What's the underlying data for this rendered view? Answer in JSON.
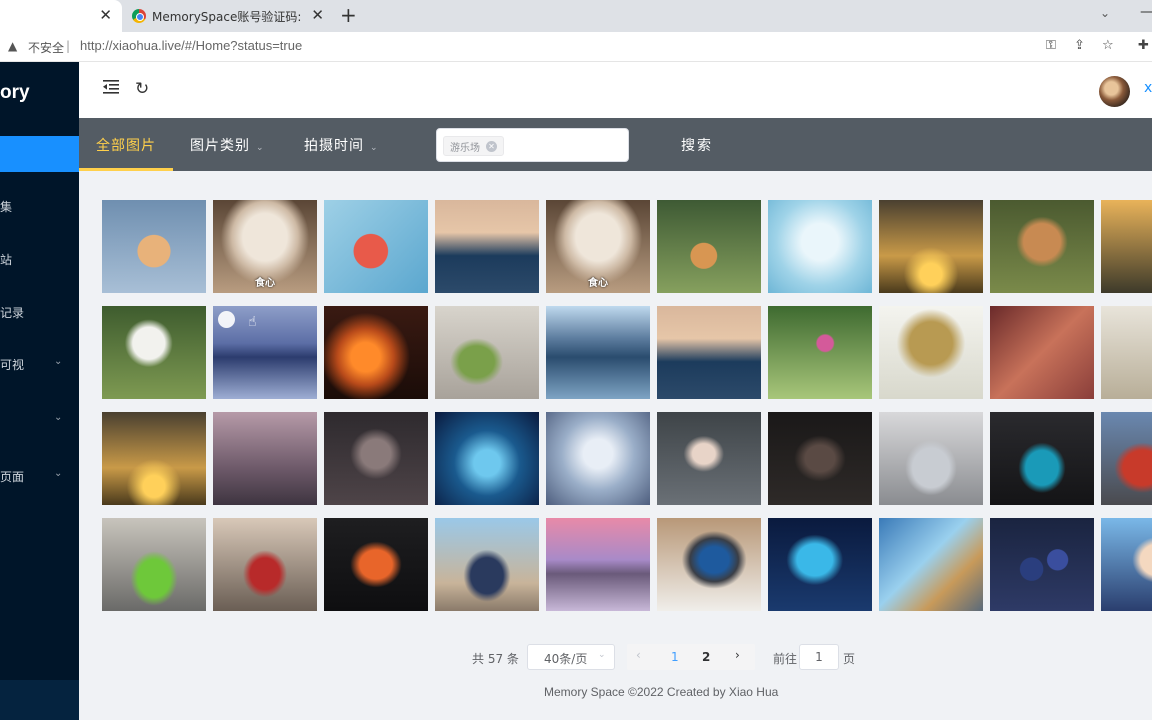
{
  "browser": {
    "tabs": [
      {
        "title": ""
      },
      {
        "title": "MemorySpace账号验证码: - C"
      }
    ],
    "new_tab": "+",
    "close_glyph": "✕",
    "insecure_label": "不安全",
    "url": "http://xiaohua.live/#/Home?status=true"
  },
  "sidebar": {
    "logo": "ory",
    "items": [
      {
        "label": "集",
        "arrow": false
      },
      {
        "label": "站",
        "arrow": false
      },
      {
        "label": "记录",
        "arrow": false
      },
      {
        "label": "可视",
        "arrow": true
      },
      {
        "label": "",
        "arrow": true
      },
      {
        "label": "页面",
        "arrow": true
      }
    ]
  },
  "header": {
    "close_glyph": "x"
  },
  "filter": {
    "tabs": [
      {
        "label": "全部图片",
        "active": true
      },
      {
        "label": "图片类别",
        "dropdown": true
      },
      {
        "label": "拍摄时间",
        "dropdown": true
      }
    ],
    "tags": [
      "游乐场"
    ],
    "search_label": "搜索"
  },
  "gallery": {
    "rows": [
      [
        {
          "subject": "cat-bowtie",
          "label": ""
        },
        {
          "subject": "cat-eating",
          "label": "食心"
        },
        {
          "subject": "watermelon",
          "label": ""
        },
        {
          "subject": "mountain-sunrise",
          "label": ""
        },
        {
          "subject": "cat-eating",
          "label": "食心"
        },
        {
          "subject": "cat-running",
          "label": ""
        },
        {
          "subject": "ice-people",
          "label": ""
        },
        {
          "subject": "sunset-tree",
          "label": ""
        },
        {
          "subject": "cat-field",
          "label": ""
        },
        {
          "subject": "sunset-partial",
          "label": ""
        }
      ],
      [
        {
          "subject": "dandelion",
          "label": ""
        },
        {
          "subject": "lake-moon",
          "label": ""
        },
        {
          "subject": "fire",
          "label": ""
        },
        {
          "subject": "green-drink",
          "label": ""
        },
        {
          "subject": "mountain-lake",
          "label": ""
        },
        {
          "subject": "mountain-sunrise",
          "label": ""
        },
        {
          "subject": "pink-flower",
          "label": ""
        },
        {
          "subject": "blossom-tree",
          "label": ""
        },
        {
          "subject": "red-tree",
          "label": ""
        },
        {
          "subject": "branch",
          "label": ""
        }
      ],
      [
        {
          "subject": "sunset-tree",
          "label": ""
        },
        {
          "subject": "pink-forest",
          "label": ""
        },
        {
          "subject": "anime-girl-dark",
          "label": ""
        },
        {
          "subject": "anime-blue-water",
          "label": ""
        },
        {
          "subject": "anime-winter",
          "label": ""
        },
        {
          "subject": "anime-girl-flower",
          "label": ""
        },
        {
          "subject": "girl-dark",
          "label": ""
        },
        {
          "subject": "silver-car",
          "label": ""
        },
        {
          "subject": "teal-car",
          "label": ""
        },
        {
          "subject": "red-car",
          "label": ""
        }
      ],
      [
        {
          "subject": "green-car",
          "label": ""
        },
        {
          "subject": "red-mustang",
          "label": ""
        },
        {
          "subject": "orange-car",
          "label": ""
        },
        {
          "subject": "bugatti",
          "label": ""
        },
        {
          "subject": "pink-sky-mountain",
          "label": ""
        },
        {
          "subject": "laptop",
          "label": ""
        },
        {
          "subject": "anime-blue-hair",
          "label": ""
        },
        {
          "subject": "skyscraper",
          "label": ""
        },
        {
          "subject": "blueberries",
          "label": ""
        },
        {
          "subject": "anime-boy",
          "label": ""
        }
      ]
    ]
  },
  "pagination": {
    "total_text": "共 57 条",
    "page_size": "40条/页",
    "pages": [
      "1",
      "2"
    ],
    "current_page": "1",
    "prev_glyph": "‹",
    "next_glyph": "›",
    "goto_label": "前往",
    "goto_value": "1",
    "page_suffix": "页"
  },
  "footer": {
    "text": "Memory Space ©2022 Created by Xiao Hua"
  },
  "colors": {
    "sidebar_bg": "#001529",
    "accent_blue": "#1890ff",
    "filter_bar": "#545c64",
    "active_tab": "#ffd04b"
  }
}
